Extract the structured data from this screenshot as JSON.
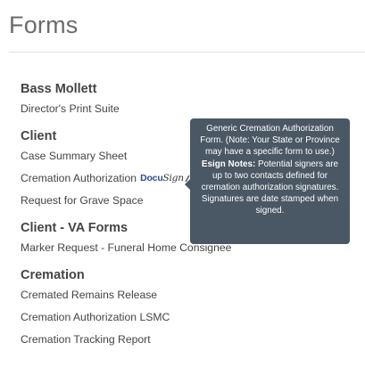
{
  "page": {
    "title": "Forms"
  },
  "sections": [
    {
      "heading": "Bass Mollett",
      "items": [
        "Director's Print Suite"
      ]
    },
    {
      "heading": "Client",
      "items": [
        "Case Summary Sheet",
        "Cremation Authorization",
        "Request for Grave Space"
      ]
    },
    {
      "heading": "Client - VA Forms",
      "items": [
        "Marker Request - Funeral Home Consignee"
      ]
    },
    {
      "heading": "Cremation",
      "items": [
        "Cremated Remains Release",
        "Cremation Authorization LSMC",
        "Cremation Tracking Report"
      ]
    }
  ],
  "docusign_badge": {
    "docu": "Docu",
    "sign": "Sign",
    "icon": "pen-icon"
  },
  "tooltip": {
    "text_before": "Generic Cremation Authorization Form. (Note: Your State or Province may have a specific form to use.)",
    "esign_label": "Esign Notes:",
    "esign_text": "Potential signers are up to two contacts defined for cremation authorization signatures. Signatures are date stamped when signed."
  },
  "colors": {
    "tooltip_bg": "#4a5764",
    "docusign_blue": "#2f4b8f",
    "title_gray": "#6b6b6b"
  }
}
